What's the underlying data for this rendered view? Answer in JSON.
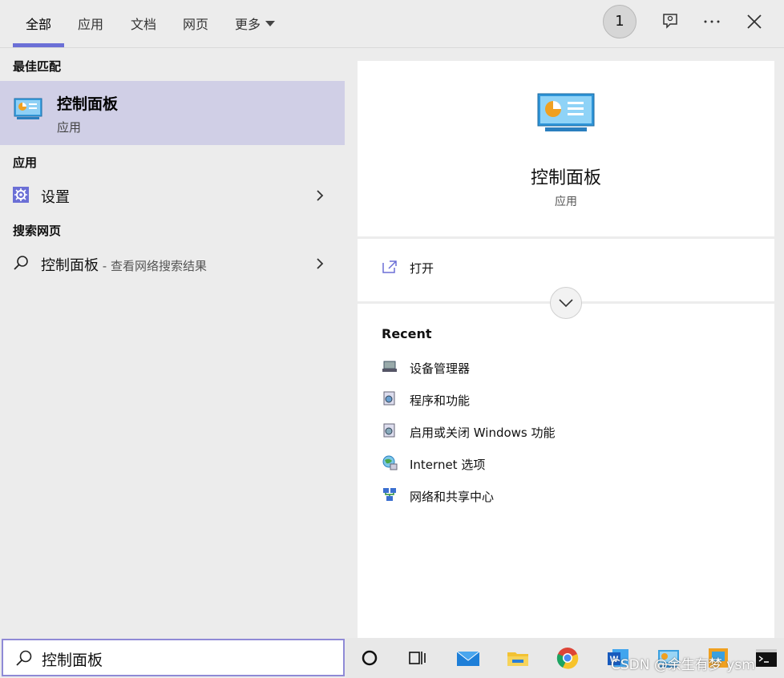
{
  "tabs": [
    {
      "label": "全部",
      "active": true
    },
    {
      "label": "应用"
    },
    {
      "label": "文档"
    },
    {
      "label": "网页"
    },
    {
      "label": "更多"
    }
  ],
  "header": {
    "badge_count": "1",
    "icons": [
      "feedback-icon",
      "more-options-icon",
      "close-icon"
    ]
  },
  "left": {
    "best_match_label": "最佳匹配",
    "best_match": {
      "title": "控制面板",
      "subtitle": "应用",
      "icon": "control-panel-icon"
    },
    "apps_label": "应用",
    "apps": [
      {
        "label": "设置",
        "icon": "settings-gear-icon"
      }
    ],
    "web_label": "搜索网页",
    "web": [
      {
        "label": "控制面板",
        "suffix": " - 查看网络搜索结果",
        "icon": "search-icon"
      }
    ]
  },
  "right": {
    "title": "控制面板",
    "subtitle": "应用",
    "open_label": "打开",
    "recent_title": "Recent",
    "recent": [
      {
        "label": "设备管理器",
        "icon": "device-manager-icon"
      },
      {
        "label": "程序和功能",
        "icon": "programs-features-icon"
      },
      {
        "label": "启用或关闭 Windows 功能",
        "icon": "windows-features-icon"
      },
      {
        "label": "Internet 选项",
        "icon": "internet-options-icon"
      },
      {
        "label": "网络和共享中心",
        "icon": "network-center-icon"
      }
    ]
  },
  "search": {
    "value": "控制面板"
  },
  "taskbar": {
    "icons": [
      "cortana-icon",
      "task-view-icon",
      "mail-icon",
      "file-explorer-icon",
      "chrome-icon",
      "word-icon",
      "control-panel-taskbar-icon",
      "app-icon",
      "terminal-icon"
    ]
  },
  "watermark": "CSDN @余生有梦 ysm",
  "colors": {
    "accent": "#6b6fd6",
    "highlight": "#d0cfe6",
    "panel": "#ececec"
  }
}
